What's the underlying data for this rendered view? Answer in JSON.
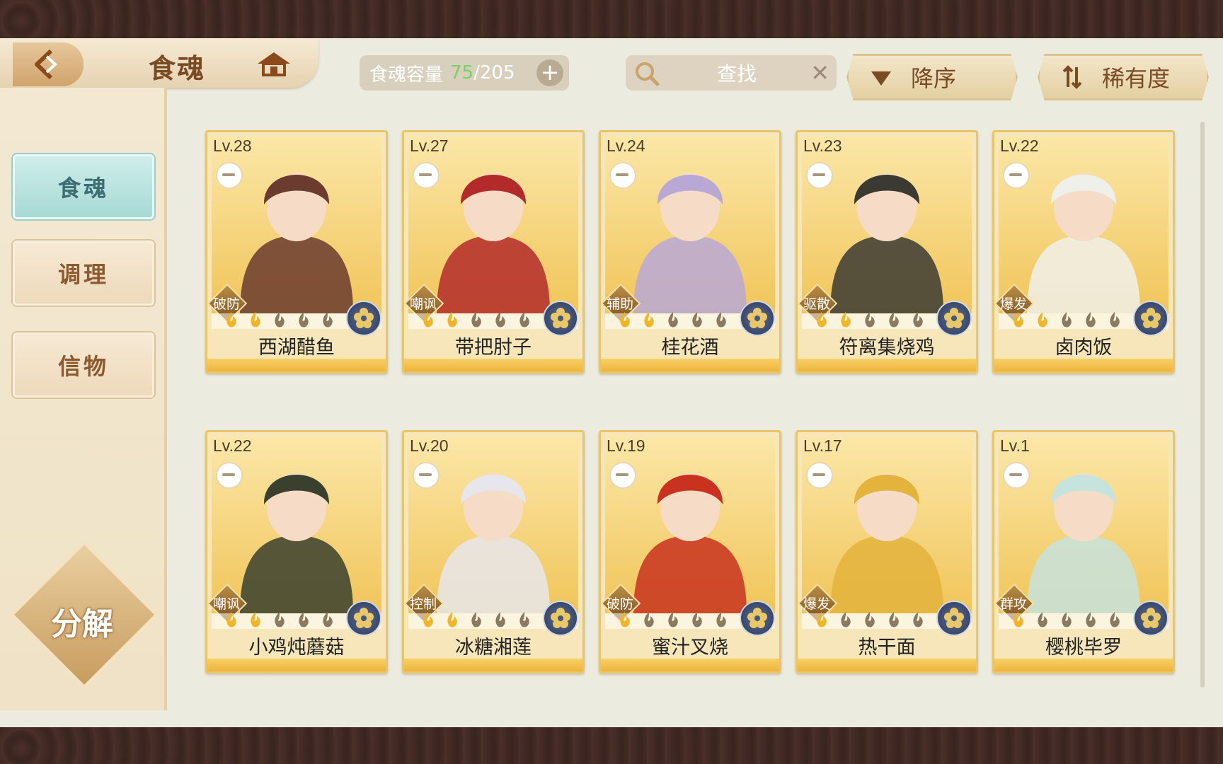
{
  "header": {
    "title": "食魂",
    "capacity_label": "食魂容量",
    "capacity_current": "75",
    "capacity_sep_max": "/205",
    "search_placeholder": "查找",
    "sort_order": "降序",
    "sort_by": "稀有度"
  },
  "sidebar": {
    "tabs": [
      {
        "label": "食魂",
        "active": true
      },
      {
        "label": "调理",
        "active": false
      },
      {
        "label": "信物",
        "active": false
      }
    ],
    "decompose_label": "分解"
  },
  "cards": [
    {
      "level": "Lv.28",
      "role": "破防",
      "name": "西湖醋鱼",
      "lit": 2,
      "hue": "#6a3b2e"
    },
    {
      "level": "Lv.27",
      "role": "嘲讽",
      "name": "带把肘子",
      "lit": 2,
      "hue": "#b32a2a"
    },
    {
      "level": "Lv.24",
      "role": "辅助",
      "name": "桂花酒",
      "lit": 2,
      "hue": "#b9a8d6"
    },
    {
      "level": "Lv.23",
      "role": "驱散",
      "name": "符离集烧鸡",
      "lit": 2,
      "hue": "#3b3a32"
    },
    {
      "level": "Lv.22",
      "role": "爆发",
      "name": "卤肉饭",
      "lit": 2,
      "hue": "#f0f0ea"
    },
    {
      "level": "Lv.22",
      "role": "嘲讽",
      "name": "小鸡炖蘑菇",
      "lit": 2,
      "hue": "#3a3f2e"
    },
    {
      "level": "Lv.20",
      "role": "控制",
      "name": "冰糖湘莲",
      "lit": 2,
      "hue": "#e6e6ec"
    },
    {
      "level": "Lv.19",
      "role": "破防",
      "name": "蜜汁叉烧",
      "lit": 1,
      "hue": "#c8321e"
    },
    {
      "level": "Lv.17",
      "role": "爆发",
      "name": "热干面",
      "lit": 1,
      "hue": "#e3b33c"
    },
    {
      "level": "Lv.1",
      "role": "群攻",
      "name": "樱桃毕罗",
      "lit": 1,
      "hue": "#c7e3dd"
    }
  ],
  "colors": {
    "accent_active_tab": "#a7d9d5",
    "card_border": "#e9c56a",
    "capacity_current": "#7bd06c"
  }
}
